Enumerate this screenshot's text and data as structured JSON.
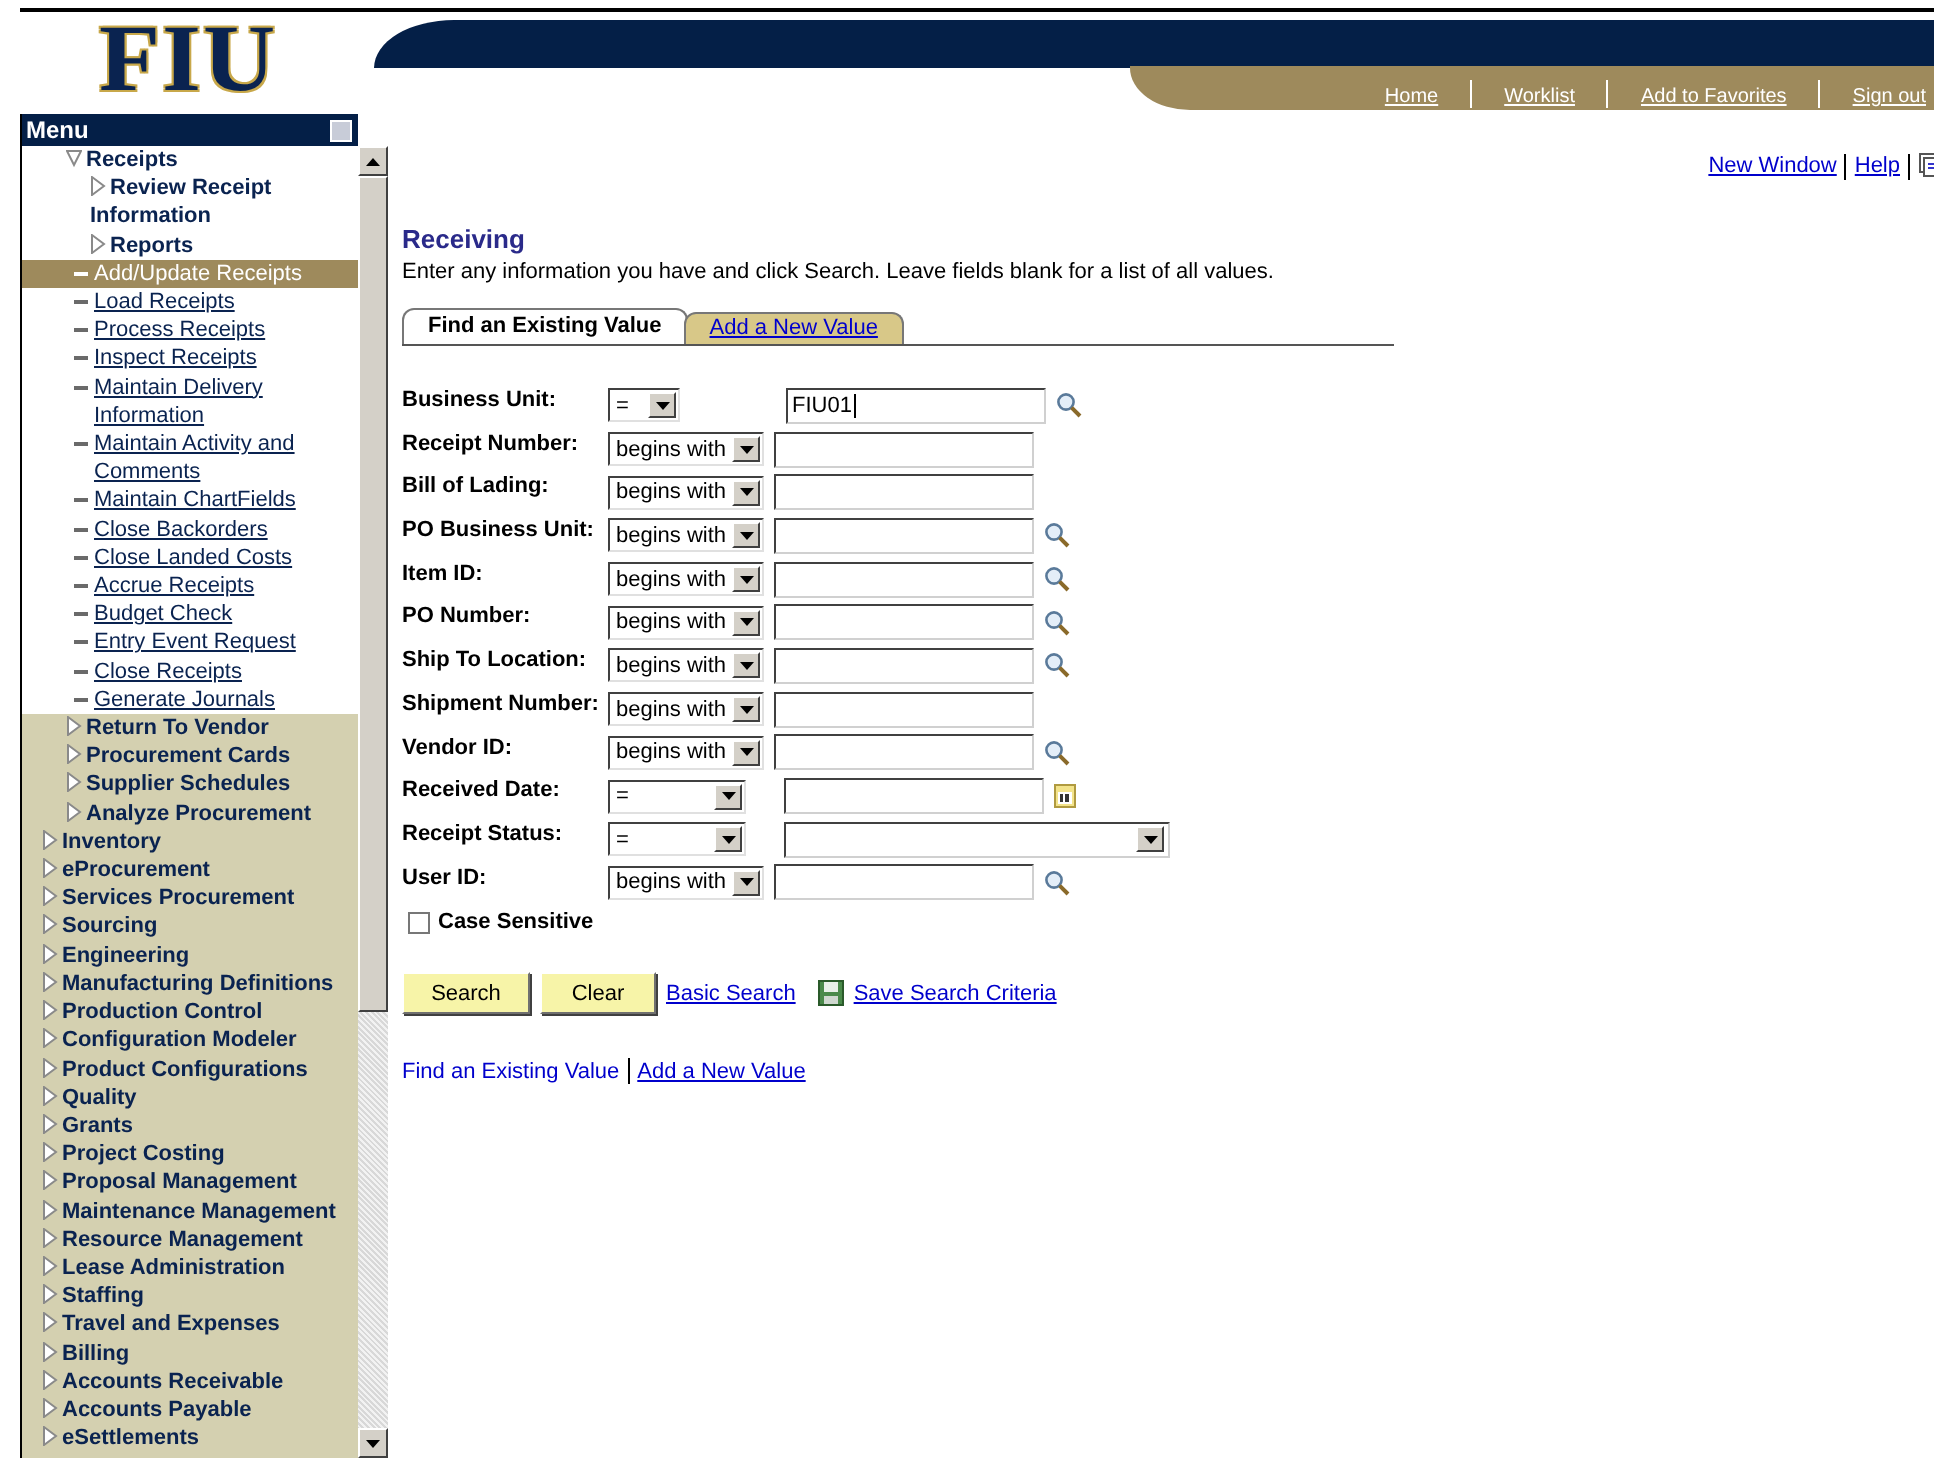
{
  "logo": "FIU",
  "header_links": [
    "Home",
    "Worklist",
    "Add to Favorites",
    "Sign out"
  ],
  "menu": {
    "title": "Menu",
    "items": [
      {
        "children": [
          {
            "label": "Receipts",
            "kind": "folder",
            "expanded": true,
            "children": [
              {
                "label": "Review Receipt Information",
                "kind": "folder",
                "expanded": false
              },
              {
                "label": "Reports",
                "kind": "folder",
                "expanded": false
              },
              {
                "label": "Add/Update Receipts",
                "kind": "link",
                "selected": true
              },
              {
                "label": "Load Receipts",
                "kind": "link",
                "selected": false
              },
              {
                "label": "Process Receipts",
                "kind": "link",
                "selected": false
              },
              {
                "label": "Inspect Receipts",
                "kind": "link",
                "selected": false
              },
              {
                "label": "Maintain Delivery Information",
                "kind": "link",
                "selected": false
              },
              {
                "label": "Maintain Activity and Comments",
                "kind": "link",
                "selected": false
              },
              {
                "label": "Maintain ChartFields",
                "kind": "link",
                "selected": false
              },
              {
                "label": "Close Backorders",
                "kind": "link",
                "selected": false
              },
              {
                "label": "Close Landed Costs",
                "kind": "link",
                "selected": false
              },
              {
                "label": "Accrue Receipts",
                "kind": "link",
                "selected": false
              },
              {
                "label": "Budget Check",
                "kind": "link",
                "selected": false
              },
              {
                "label": "Entry Event Request",
                "kind": "link",
                "selected": false
              },
              {
                "label": "Close Receipts",
                "kind": "link",
                "selected": false
              },
              {
                "label": "Generate Journals",
                "kind": "link",
                "selected": false
              }
            ]
          },
          {
            "label": "Return To Vendor",
            "kind": "folder",
            "expanded": false
          },
          {
            "label": "Procurement Cards",
            "kind": "folder",
            "expanded": false
          },
          {
            "label": "Supplier Schedules",
            "kind": "folder",
            "expanded": false
          },
          {
            "label": "Analyze Procurement",
            "kind": "folder",
            "expanded": false
          }
        ]
      },
      {
        "label": "Inventory",
        "kind": "folder",
        "expanded": false
      },
      {
        "label": "eProcurement",
        "kind": "folder",
        "expanded": false
      },
      {
        "label": "Services Procurement",
        "kind": "folder",
        "expanded": false
      },
      {
        "label": "Sourcing",
        "kind": "folder",
        "expanded": false
      },
      {
        "label": "Engineering",
        "kind": "folder",
        "expanded": false
      },
      {
        "label": "Manufacturing Definitions",
        "kind": "folder",
        "expanded": false
      },
      {
        "label": "Production Control",
        "kind": "folder",
        "expanded": false
      },
      {
        "label": "Configuration Modeler",
        "kind": "folder",
        "expanded": false
      },
      {
        "label": "Product Configurations",
        "kind": "folder",
        "expanded": false
      },
      {
        "label": "Quality",
        "kind": "folder",
        "expanded": false
      },
      {
        "label": "Grants",
        "kind": "folder",
        "expanded": false
      },
      {
        "label": "Project Costing",
        "kind": "folder",
        "expanded": false
      },
      {
        "label": "Proposal Management",
        "kind": "folder",
        "expanded": false
      },
      {
        "label": "Maintenance Management",
        "kind": "folder",
        "expanded": false
      },
      {
        "label": "Resource Management",
        "kind": "folder",
        "expanded": false
      },
      {
        "label": "Lease Administration",
        "kind": "folder",
        "expanded": false
      },
      {
        "label": "Staffing",
        "kind": "folder",
        "expanded": false
      },
      {
        "label": "Travel and Expenses",
        "kind": "folder",
        "expanded": false
      },
      {
        "label": "Billing",
        "kind": "folder",
        "expanded": false
      },
      {
        "label": "Accounts Receivable",
        "kind": "folder",
        "expanded": false
      },
      {
        "label": "Accounts Payable",
        "kind": "folder",
        "expanded": false
      },
      {
        "label": "eSettlements",
        "kind": "folder",
        "expanded": false
      }
    ]
  },
  "page_links": [
    "New Window",
    "Help"
  ],
  "page": {
    "title": "Receiving",
    "instructions": "Enter any information you have and click Search. Leave fields blank for a list of all values.",
    "tabs": [
      {
        "label": "Find an Existing Value",
        "selected": true
      },
      {
        "label": "Add a New Value",
        "selected": false
      }
    ],
    "criteria": [
      {
        "label": "Business Unit:",
        "operator": "=",
        "kind": "lookup",
        "value": "FIU01"
      },
      {
        "label": "Receipt Number:",
        "operator": "begins with",
        "kind": "plain"
      },
      {
        "label": "Bill of Lading:",
        "operator": "begins with",
        "kind": "plain"
      },
      {
        "label": "PO Business Unit:",
        "operator": "begins with",
        "kind": "lookup"
      },
      {
        "label": "Item ID:",
        "operator": "begins with",
        "kind": "lookup"
      },
      {
        "label": "PO Number:",
        "operator": "begins with",
        "kind": "lookup"
      },
      {
        "label": "Ship To Location:",
        "operator": "begins with",
        "kind": "lookup"
      },
      {
        "label": "Shipment Number:",
        "operator": "begins with",
        "kind": "plain"
      },
      {
        "label": "Vendor ID:",
        "operator": "begins with",
        "kind": "lookup"
      },
      {
        "label": "Received Date:",
        "operator": "=",
        "kind": "date"
      },
      {
        "label": "Receipt Status:",
        "operator": "=",
        "kind": "dropdown"
      },
      {
        "label": "User ID:",
        "operator": "begins with",
        "kind": "lookup"
      }
    ],
    "case_sensitive": {
      "label": "Case Sensitive",
      "checked": false
    },
    "buttons": [
      "Search",
      "Clear"
    ],
    "search_links": [
      "Basic Search",
      "Save Search Criteria"
    ],
    "footer_links": [
      "Find an Existing Value",
      "Add a New Value"
    ]
  }
}
